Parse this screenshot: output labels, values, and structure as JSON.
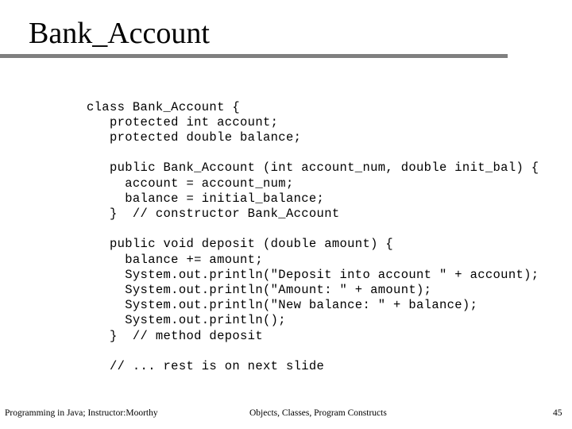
{
  "slide": {
    "title": "Bank_Account",
    "rule_color": "#808080",
    "background_color": "#ffffff",
    "text_color": "#000000"
  },
  "code": {
    "language": "java",
    "lines": [
      "class Bank_Account {",
      "   protected int account;",
      "   protected double balance;",
      "",
      "   public Bank_Account (int account_num, double init_bal) {",
      "     account = account_num;",
      "     balance = initial_balance;",
      "   }  // constructor Bank_Account",
      "",
      "   public void deposit (double amount) {",
      "     balance += amount;",
      "     System.out.println(\"Deposit into account \" + account);",
      "     System.out.println(\"Amount: \" + amount);",
      "     System.out.println(\"New balance: \" + balance);",
      "     System.out.println();",
      "   }  // method deposit",
      "",
      "   // ... rest is on next slide"
    ]
  },
  "footer": {
    "left": "Programming in Java; Instructor:Moorthy",
    "center": "Objects, Classes, Program Constructs",
    "page_number": "45"
  }
}
